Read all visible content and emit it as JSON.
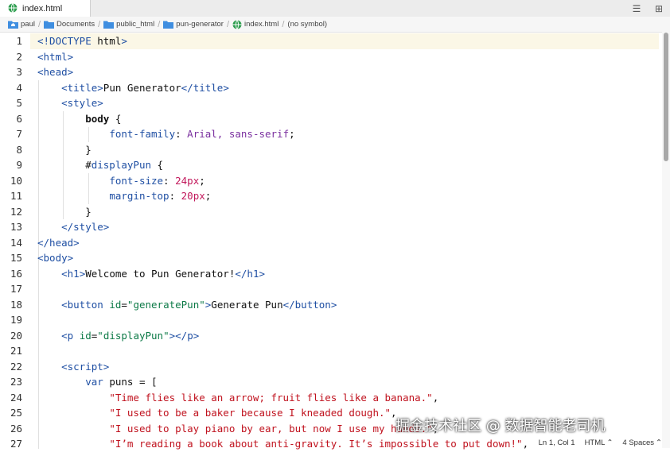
{
  "tab": {
    "title": "index.html"
  },
  "breadcrumb": {
    "items": [
      "paul",
      "Documents",
      "public_html",
      "pun-generator",
      "index.html",
      "(no symbol)"
    ]
  },
  "editor": {
    "line_numbers": [
      "1",
      "2",
      "3",
      "4",
      "5",
      "6",
      "7",
      "8",
      "9",
      "10",
      "11",
      "12",
      "13",
      "14",
      "15",
      "16",
      "17",
      "18",
      "19",
      "20",
      "21",
      "22",
      "23",
      "24",
      "25",
      "26",
      "27"
    ],
    "lines": [
      {
        "text": "<!DOCTYPE html>"
      },
      {
        "text": "<html>"
      },
      {
        "text": "<head>"
      },
      {
        "text": "    <title>Pun Generator</title>"
      },
      {
        "text": "    <style>"
      },
      {
        "text": "        body {"
      },
      {
        "text": "            font-family: Arial, sans-serif;"
      },
      {
        "text": "        }"
      },
      {
        "text": "        #displayPun {"
      },
      {
        "text": "            font-size: 24px;"
      },
      {
        "text": "            margin-top: 20px;"
      },
      {
        "text": "        }"
      },
      {
        "text": "    </style>"
      },
      {
        "text": "</head>"
      },
      {
        "text": "<body>"
      },
      {
        "text": "    <h1>Welcome to Pun Generator!</h1>"
      },
      {
        "text": ""
      },
      {
        "text": "    <button id=\"generatePun\">Generate Pun</button>"
      },
      {
        "text": ""
      },
      {
        "text": "    <p id=\"displayPun\"></p>"
      },
      {
        "text": ""
      },
      {
        "text": "    <script>"
      },
      {
        "text": "        var puns = ["
      },
      {
        "text": "            \"Time flies like an arrow; fruit flies like a banana.\","
      },
      {
        "text": "            \"I used to be a baker because I kneaded dough.\","
      },
      {
        "text": "            \"I used to play piano by ear, but now I use my hands.\","
      },
      {
        "text": "            \"I’m reading a book about anti-gravity. It’s impossible to put down!\","
      }
    ]
  },
  "status": {
    "position": "Ln 1, Col 1",
    "language": "HTML",
    "indent": "4 Spaces"
  },
  "watermark": "掘金技术社区 @ 数据智能老司机"
}
